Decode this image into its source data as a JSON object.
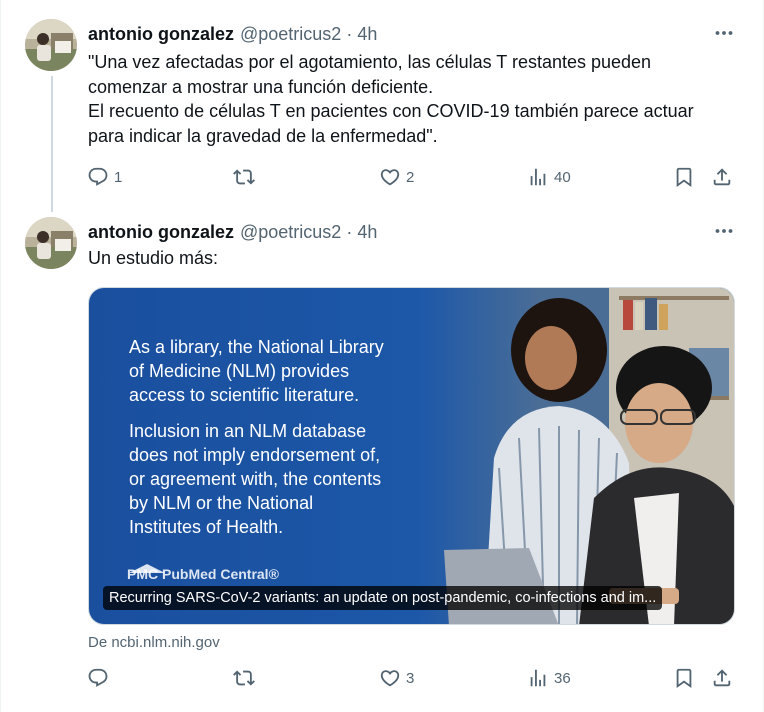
{
  "tweets": [
    {
      "author_name": "antonio gonzalez",
      "handle": "@poetricus2",
      "separator": "·",
      "time": "4h",
      "text_lines": [
        "\"Una vez afectadas por el agotamiento, las células T restantes pueden",
        "comenzar a mostrar una función deficiente.",
        "El recuento de células T en pacientes con COVID-19 también parece actuar",
        "para indicar la gravedad de la enfermedad\"."
      ],
      "replies": "1",
      "retweets": "",
      "likes": "2",
      "views": "40"
    },
    {
      "author_name": "antonio gonzalez",
      "handle": "@poetricus2",
      "separator": "·",
      "time": "4h",
      "text_lines": [
        "Un estudio más:"
      ],
      "card": {
        "image_text_p1": [
          "As a library, the National Library",
          "of Medicine (NLM) provides",
          "access to scientific literature."
        ],
        "image_text_p2": [
          "Inclusion in an NLM database",
          "does not imply endorsement of,",
          "or agreement with, the contents",
          "by NLM or the National",
          "Institutes of Health."
        ],
        "logo_text": "PMC PubMed Central®",
        "caption": "Recurring SARS-CoV-2 variants: an update on post-pandemic, co-infections and im..."
      },
      "source": "De ncbi.nlm.nih.gov",
      "replies": "",
      "retweets": "",
      "likes": "3",
      "views": "36"
    }
  ],
  "icons": {
    "more": "more-dots-icon",
    "reply": "reply-icon",
    "retweet": "retweet-icon",
    "like": "heart-icon",
    "views": "views-icon",
    "bookmark": "bookmark-icon",
    "share": "share-icon"
  },
  "colors": {
    "text_primary": "#0f1419",
    "text_secondary": "#536471",
    "divider": "#eff3f4",
    "card_blue": "#1c55a8"
  }
}
